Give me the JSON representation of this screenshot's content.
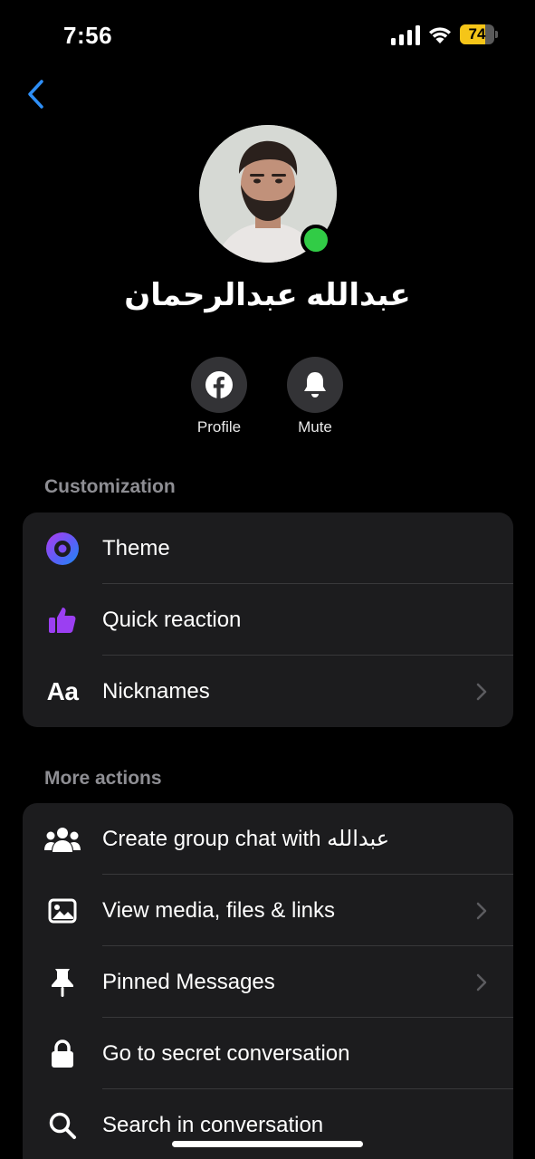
{
  "status_bar": {
    "time": "7:56",
    "battery": "74",
    "battery_level": 0.74,
    "battery_color": "#f5c518"
  },
  "header": {
    "back_icon": "chevron-left-icon",
    "contact_name": "عبدالله عبدالرحمان",
    "presence_color": "#31cc46"
  },
  "quick_actions": [
    {
      "label": "Profile",
      "icon": "facebook-icon"
    },
    {
      "label": "Mute",
      "icon": "bell-icon"
    }
  ],
  "customization": {
    "title": "Customization",
    "items": [
      {
        "label": "Theme",
        "icon": "theme-icon"
      },
      {
        "label": "Quick reaction",
        "icon": "thumbs-up-icon"
      },
      {
        "label": "Nicknames",
        "icon": "text-aa-icon"
      }
    ]
  },
  "more_actions": {
    "title": "More actions",
    "items": [
      {
        "label": "Create group chat with عبدالله",
        "icon": "people-icon"
      },
      {
        "label": "View media, files & links",
        "icon": "image-icon"
      },
      {
        "label": "Pinned Messages",
        "icon": "pin-icon"
      },
      {
        "label": "Go to secret conversation",
        "icon": "lock-icon"
      },
      {
        "label": "Search in conversation",
        "icon": "search-icon"
      }
    ]
  },
  "colors": {
    "accent": "#2e8ff7",
    "card_bg": "#1c1c1e",
    "reaction_purple": "#9b3ff2"
  }
}
